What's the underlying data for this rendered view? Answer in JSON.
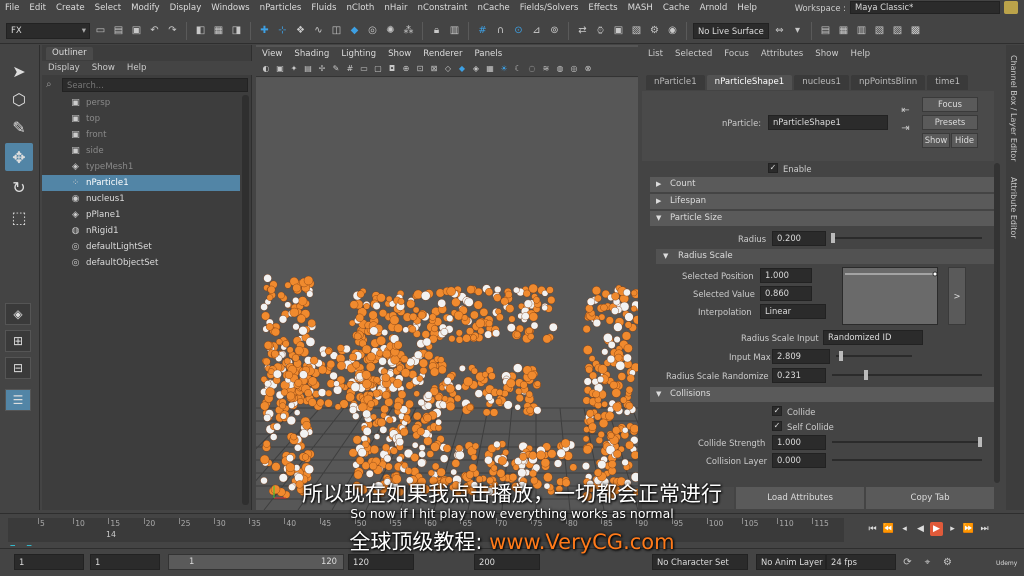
{
  "menubar": {
    "items": [
      "File",
      "Edit",
      "Create",
      "Select",
      "Modify",
      "Display",
      "Windows",
      "nParticles",
      "Fluids",
      "nCloth",
      "nHair",
      "nConstraint",
      "nCache",
      "Fields/Solvers",
      "Effects",
      "MASH",
      "Cache",
      "Arnold",
      "Help"
    ],
    "workspace_label": "Workspace :",
    "workspace_value": "Maya Classic*"
  },
  "statusline": {
    "mode": "FX",
    "live_surface": "No Live Surface"
  },
  "outliner": {
    "tab": "Outliner",
    "menu": [
      "Display",
      "Show",
      "Help"
    ],
    "search_placeholder": "Search...",
    "items": [
      {
        "label": "persp",
        "icon": "camera-icon",
        "dim": true
      },
      {
        "label": "top",
        "icon": "camera-icon",
        "dim": true
      },
      {
        "label": "front",
        "icon": "camera-icon",
        "dim": true
      },
      {
        "label": "side",
        "icon": "camera-icon",
        "dim": true
      },
      {
        "label": "typeMesh1",
        "icon": "mesh-icon",
        "dim": true
      },
      {
        "label": "nParticle1",
        "icon": "nparticle-icon",
        "selected": true
      },
      {
        "label": "nucleus1",
        "icon": "nucleus-icon"
      },
      {
        "label": "pPlane1",
        "icon": "mesh-icon"
      },
      {
        "label": "nRigid1",
        "icon": "nrigid-icon"
      },
      {
        "label": "defaultLightSet",
        "icon": "set-icon"
      },
      {
        "label": "defaultObjectSet",
        "icon": "set-icon"
      }
    ]
  },
  "viewport": {
    "menu": [
      "View",
      "Shading",
      "Lighting",
      "Show",
      "Renderer",
      "Panels"
    ]
  },
  "attribute_editor": {
    "menu": [
      "List",
      "Selected",
      "Focus",
      "Attributes",
      "Show",
      "Help"
    ],
    "tabs": [
      "nParticle1",
      "nParticleShape1",
      "nucleus1",
      "npPointsBlinn",
      "time1"
    ],
    "node_label": "nParticle:",
    "node_value": "nParticleShape1",
    "buttons": {
      "focus": "Focus",
      "presets": "Presets",
      "show": "Show",
      "hide": "Hide"
    },
    "enable_label": "Enable",
    "sections": {
      "count": "Count",
      "lifespan": "Lifespan",
      "particle_size": "Particle Size",
      "radius_scale": "Radius Scale",
      "collisions": "Collisions"
    },
    "fields": {
      "radius_label": "Radius",
      "radius_value": "0.200",
      "selected_position_label": "Selected Position",
      "selected_position_value": "1.000",
      "selected_value_label": "Selected Value",
      "selected_value_value": "0.860",
      "interpolation_label": "Interpolation",
      "interpolation_value": "Linear",
      "radius_scale_input_label": "Radius Scale Input",
      "radius_scale_input_value": "Randomized ID",
      "input_max_label": "Input Max",
      "input_max_value": "2.809",
      "radius_scale_randomize_label": "Radius Scale Randomize",
      "radius_scale_randomize_value": "0.231",
      "collide_label": "Collide",
      "self_collide_label": "Self Collide",
      "collide_strength_label": "Collide Strength",
      "collide_strength_value": "1.000",
      "collision_layer_label": "Collision Layer",
      "collision_layer_value": "0.000"
    },
    "ramp_expand": ">",
    "bottom_buttons": {
      "load": "Load Attributes",
      "copy": "Copy Tab"
    }
  },
  "side_tabs": {
    "channel_box": "Channel Box / Layer Editor",
    "attribute_editor": "Attribute Editor"
  },
  "timeline": {
    "ticks": [
      "5",
      "10",
      "15",
      "20",
      "25",
      "30",
      "35",
      "40",
      "45",
      "50",
      "55",
      "60",
      "65",
      "70",
      "75",
      "80",
      "85",
      "90",
      "95",
      "100",
      "105",
      "110",
      "115"
    ],
    "current_frame": "14"
  },
  "rangebar": {
    "start_frame": "1",
    "anim_start": "1",
    "range_start_value": "1",
    "range_end_value": "120",
    "anim_end": "120",
    "end_frame": "200",
    "character_set": "No Character Set",
    "anim_layer": "No Anim Layer",
    "fps": "24 fps"
  },
  "subtitles": {
    "chinese": "所以现在如果我点击播放，一切都会正常进行",
    "english": "So now if I hit play now everything works as normal",
    "watermark_prefix": "全球顶级教程:",
    "watermark_url": "www.VeryCG.com"
  },
  "watermark_small": "Udemy",
  "colors": {
    "selection": "#5285a6",
    "particle_orange": "#f08a2e",
    "particle_white": "#f2f2f2",
    "play_button": "#e05a3a"
  }
}
